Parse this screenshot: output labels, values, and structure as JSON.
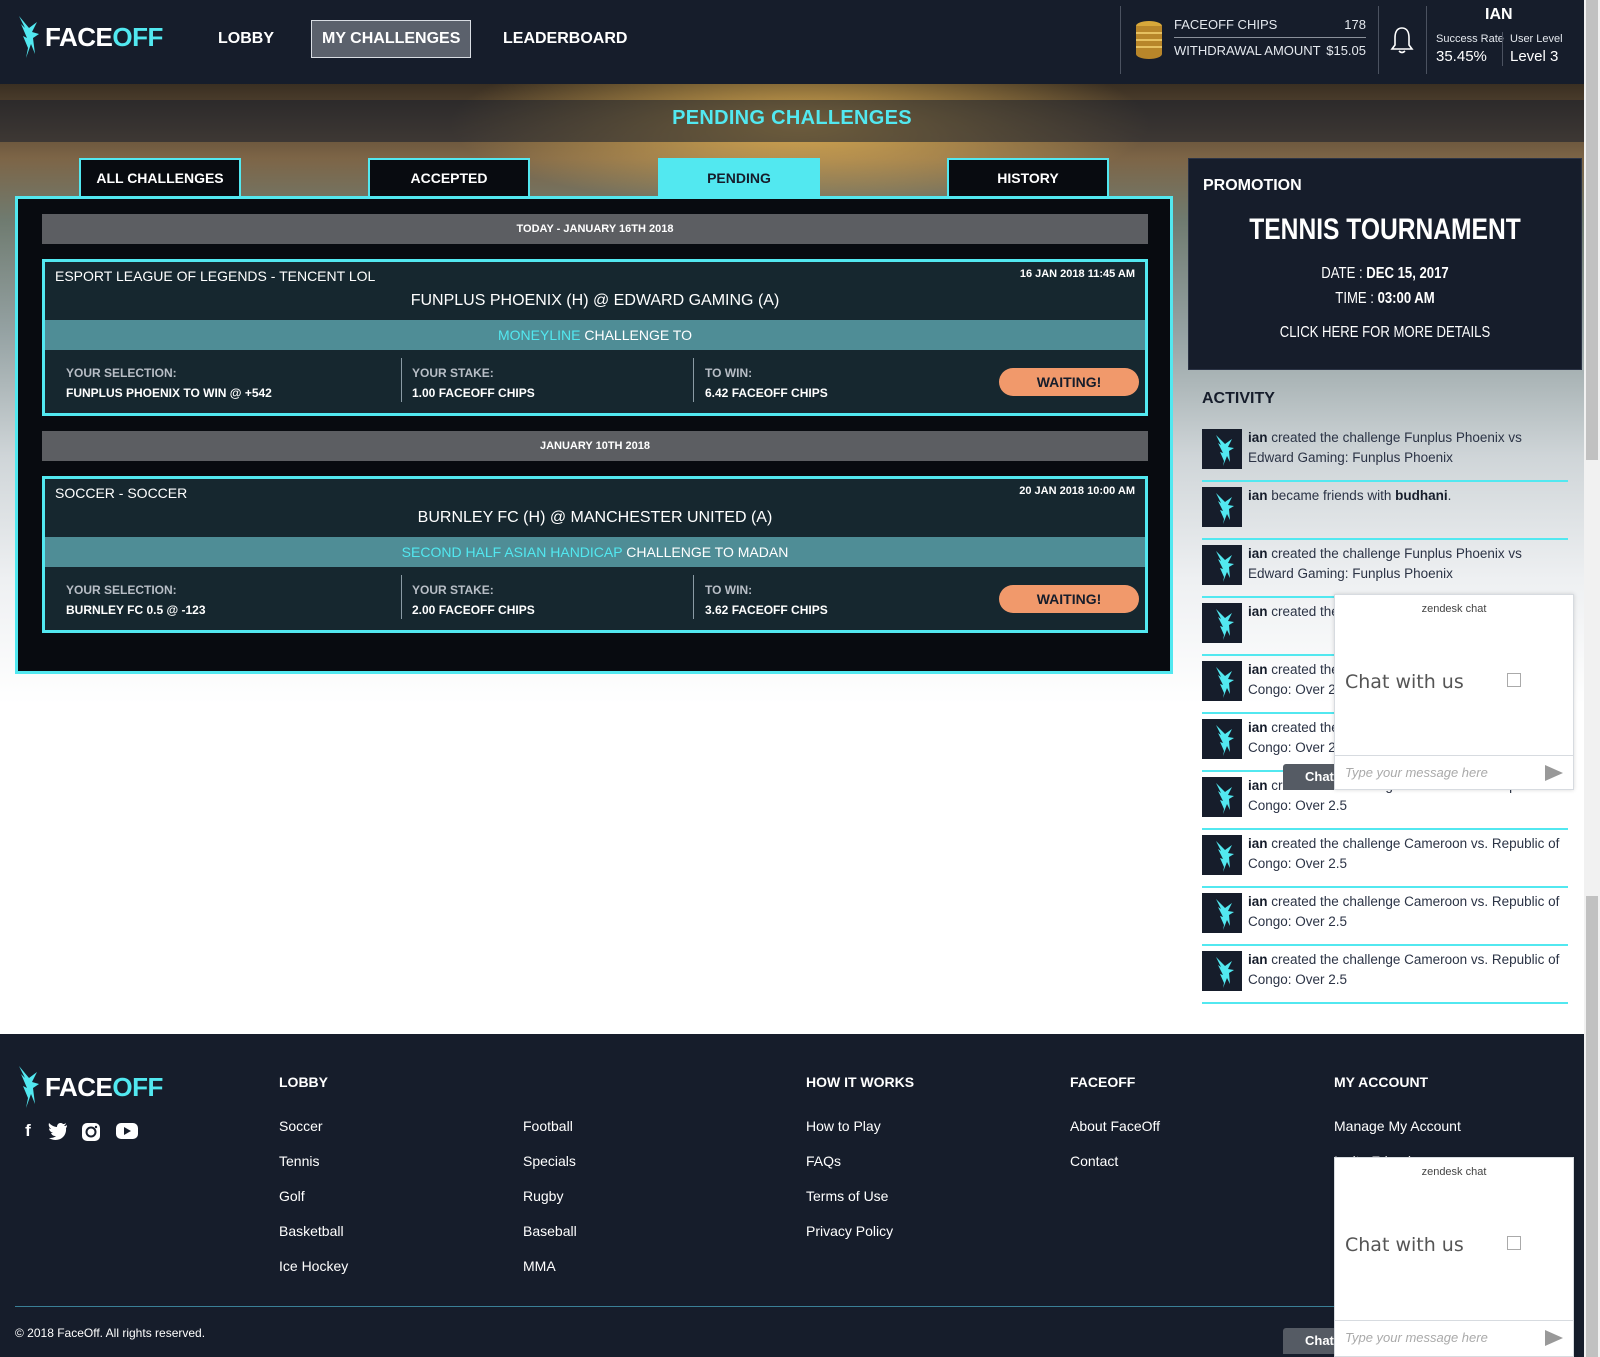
{
  "header": {
    "logo": {
      "face": "FACE",
      "off": "OFF"
    },
    "nav": [
      "LOBBY",
      "MY CHALLENGES",
      "LEADERBOARD"
    ],
    "active_nav": "MY CHALLENGES",
    "chips_label": "FACEOFF CHIPS",
    "chips_value": "178",
    "withdrawal_label": "WITHDRAWAL AMOUNT",
    "withdrawal_value": "$15.05",
    "user_name": "IAN",
    "success_rate_label": "Success Rate",
    "success_rate_value": "35.45%",
    "user_level_label": "User Level",
    "user_level_value": "Level 3"
  },
  "page_title": "PENDING CHALLENGES",
  "tabs": [
    "ALL CHALLENGES",
    "ACCEPTED",
    "PENDING",
    "HISTORY"
  ],
  "active_tab": "PENDING",
  "groups": [
    {
      "date": "TODAY - JANUARY 16TH 2018",
      "card": {
        "sport": "ESPORT LEAGUE OF LEGENDS - TENCENT LOL",
        "time": "16 JAN 2018 11:45 AM",
        "match": "FUNPLUS PHOENIX (H) @ EDWARD GAMING (A)",
        "bet_type": "MONEYLINE",
        "challenge_to": "CHALLENGE TO",
        "selection_label": "YOUR SELECTION:",
        "selection_value": "FUNPLUS PHOENIX TO WIN @ +542",
        "stake_label": "YOUR STAKE:",
        "stake_value": "1.00 FACEOFF CHIPS",
        "win_label": "TO WIN:",
        "win_value": "6.42 FACEOFF CHIPS",
        "status": "WAITING!"
      }
    },
    {
      "date": "JANUARY 10TH 2018",
      "card": {
        "sport": "SOCCER - SOCCER",
        "time": "20 JAN 2018 10:00 AM",
        "match": "BURNLEY FC (H) @ MANCHESTER UNITED (A)",
        "bet_type": "SECOND HALF ASIAN HANDICAP",
        "challenge_to": "CHALLENGE TO MADAN",
        "selection_label": "YOUR SELECTION:",
        "selection_value": "BURNLEY FC 0.5 @ -123",
        "stake_label": "YOUR STAKE:",
        "stake_value": "2.00 FACEOFF CHIPS",
        "win_label": "TO WIN:",
        "win_value": "3.62 FACEOFF CHIPS",
        "status": "WAITING!"
      }
    }
  ],
  "promotion": {
    "label": "PROMOTION",
    "title": "TENNIS TOURNAMENT",
    "date_label": "DATE :",
    "date_value": "DEC 15, 2017",
    "time_label": "TIME :",
    "time_value": "03:00 AM",
    "cta": "CLICK HERE FOR MORE DETAILS"
  },
  "activity": {
    "title": "ACTIVITY",
    "items": [
      {
        "user": "ian",
        "text": " created the challenge Funplus Phoenix vs Edward Gaming: Funplus Phoenix",
        "extra": ""
      },
      {
        "user": "ian",
        "text": " became friends with ",
        "extra": "budhani",
        "tail": "."
      },
      {
        "user": "ian",
        "text": " created the challenge Funplus Phoenix vs Edward Gaming: Funplus Phoenix",
        "extra": ""
      },
      {
        "user": "ian",
        "text": " created the challenge Skyville",
        "extra": ""
      },
      {
        "user": "ian",
        "text": " created the challenge Cameroon vs. Republic of Congo: Over 2.5",
        "extra": ""
      },
      {
        "user": "ian",
        "text": " created the challenge Cameroon vs. Republic of Congo: Over 2.5",
        "extra": ""
      },
      {
        "user": "ian",
        "text": " created the challenge Cameroon vs. Republic of Congo: Over 2.5",
        "extra": ""
      },
      {
        "user": "ian",
        "text": " created the challenge Cameroon vs. Republic of Congo: Over 2.5",
        "extra": ""
      },
      {
        "user": "ian",
        "text": " created the challenge Cameroon vs. Republic of Congo: Over 2.5",
        "extra": ""
      },
      {
        "user": "ian",
        "text": " created the challenge Cameroon vs. Republic of Congo: Over 2.5",
        "extra": ""
      }
    ]
  },
  "zendesk": {
    "header": "zendesk chat",
    "chat_text": "Chat with us",
    "placeholder": "Type your message here",
    "tab_label": "Chat"
  },
  "footer": {
    "logo": {
      "face": "FACE",
      "off": "OFF"
    },
    "lobby_heading": "LOBBY",
    "lobby_col1": [
      "Soccer",
      "Tennis",
      "Golf",
      "Basketball",
      "Ice Hockey"
    ],
    "lobby_col2": [
      "Football",
      "Specials",
      "Rugby",
      "Baseball",
      "MMA"
    ],
    "how_heading": "HOW IT WORKS",
    "how_links": [
      "How to Play",
      "FAQs",
      "Terms of Use",
      "Privacy Policy"
    ],
    "faceoff_heading": "FACEOFF",
    "faceoff_links": [
      "About FaceOff",
      "Contact"
    ],
    "account_heading": "MY ACCOUNT",
    "account_links": [
      "Manage My Account",
      "Invite Friends"
    ],
    "copyright": "© 2018 FaceOff. All rights reserved.",
    "social": [
      "facebook-icon",
      "twitter-icon",
      "instagram-icon",
      "youtube-icon"
    ]
  },
  "colors": {
    "navy": "#161d2b",
    "cyan": "#52e8f0",
    "waiting": "#f1996b",
    "band": "#4f8d96"
  }
}
